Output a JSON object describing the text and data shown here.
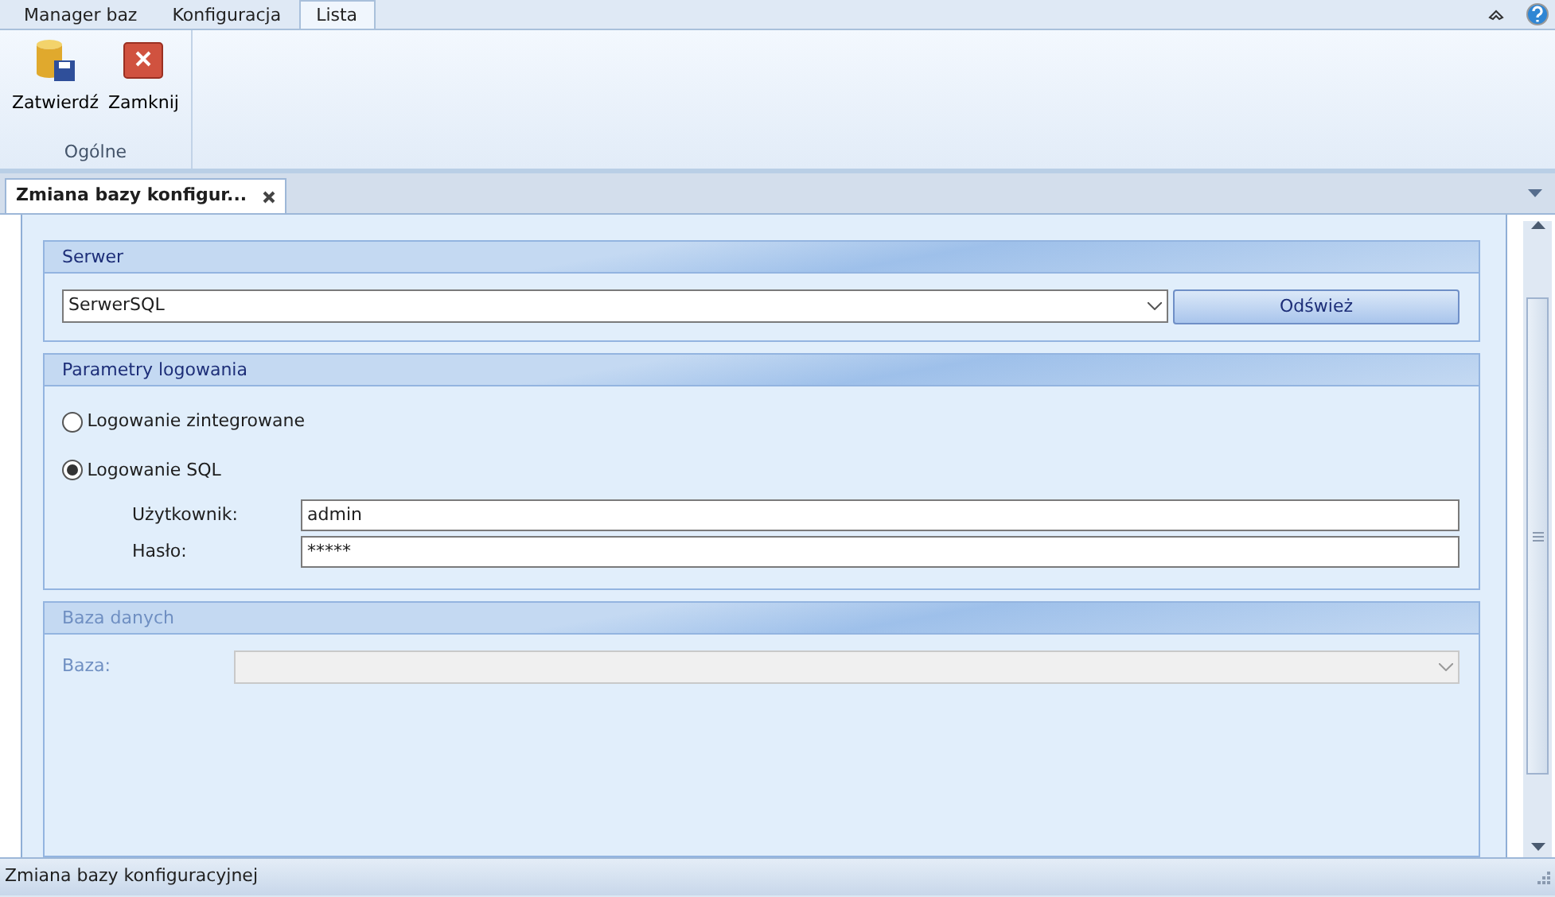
{
  "ribbon_tabs": [
    {
      "label": "Manager baz",
      "selected": false
    },
    {
      "label": "Konfiguracja",
      "selected": false
    },
    {
      "label": "Lista",
      "selected": true
    }
  ],
  "ribbon": {
    "buttons": [
      {
        "label": "Zatwierdź",
        "kind": "confirm"
      },
      {
        "label": "Zamknij",
        "kind": "close"
      }
    ],
    "group_label": "Ogólne"
  },
  "document_tabs": [
    {
      "title": "Zmiana bazy konfigur...",
      "selected": true
    }
  ],
  "server_group": {
    "title": "Serwer",
    "value": "SerwerSQL",
    "button": "Odśwież"
  },
  "login_group": {
    "title": "Parametry logowania",
    "options": [
      {
        "label": "Logowanie zintegrowane",
        "selected": false
      },
      {
        "label": "Logowanie SQL",
        "selected": true
      }
    ],
    "fields": [
      {
        "label": "Użytkownik:",
        "value": "admin"
      },
      {
        "label": "Hasło:",
        "value": "*****"
      }
    ]
  },
  "database_group": {
    "title": "Baza danych",
    "disabled": true,
    "field_label": "Baza:"
  },
  "status_bar": "Zmiana bazy konfiguracyjnej"
}
